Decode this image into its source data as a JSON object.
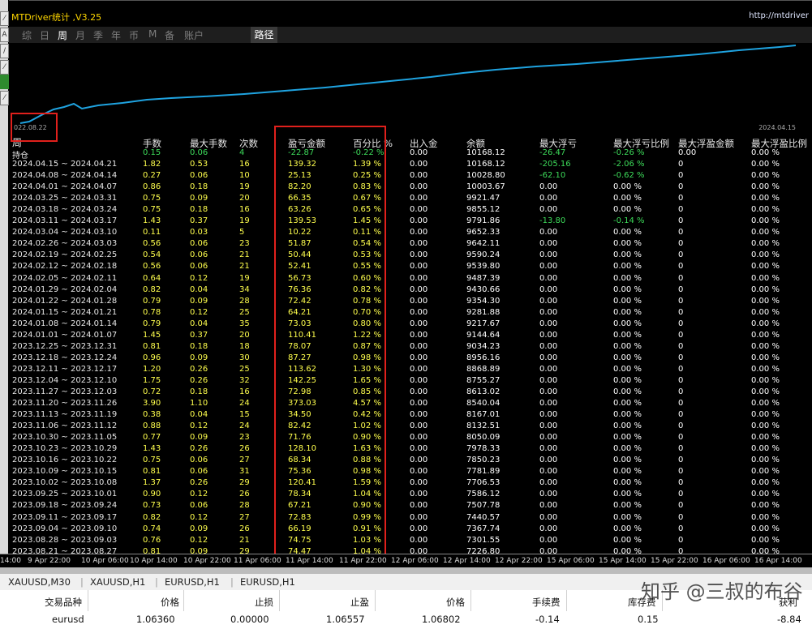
{
  "app": {
    "title": "MTDriver统计 ,V3.25",
    "url": "http://mtdriver"
  },
  "period_tabs": [
    "综",
    "日",
    "周",
    "月",
    "季",
    "年",
    "币",
    "M",
    "备",
    "账户"
  ],
  "active_tab": "周",
  "route_button": "路径",
  "chart": {
    "start_label": "022.08.22",
    "end_label": "2024.04.15"
  },
  "table": {
    "row_header": "周",
    "columns": [
      "手数",
      "最大手数",
      "次数",
      "盈亏金额",
      "百分比 %",
      "出入金",
      "余额",
      "最大浮亏",
      "最大浮亏比例",
      "最大浮盈金额",
      "最大浮盈比例"
    ],
    "rows": [
      [
        "持仓",
        "0.15",
        "0.06",
        "4",
        "-22.87",
        "-0.22 %",
        "0.00",
        "10168.12",
        "-26.47",
        "-0.26 %",
        "0.00",
        "0.00 %"
      ],
      [
        "2024.04.15 ~ 2024.04.21",
        "1.82",
        "0.53",
        "16",
        "139.32",
        "1.39 %",
        "0.00",
        "10168.12",
        "-205.16",
        "-2.06 %",
        "0",
        "0.00 %"
      ],
      [
        "2024.04.08 ~ 2024.04.14",
        "0.27",
        "0.06",
        "10",
        "25.13",
        "0.25 %",
        "0.00",
        "10028.80",
        "-62.10",
        "-0.62 %",
        "0",
        "0.00 %"
      ],
      [
        "2024.04.01 ~ 2024.04.07",
        "0.86",
        "0.18",
        "19",
        "82.20",
        "0.83 %",
        "0.00",
        "10003.67",
        "0.00",
        "0.00 %",
        "0",
        "0.00 %"
      ],
      [
        "2024.03.25 ~ 2024.03.31",
        "0.75",
        "0.09",
        "20",
        "66.35",
        "0.67 %",
        "0.00",
        "9921.47",
        "0.00",
        "0.00 %",
        "0",
        "0.00 %"
      ],
      [
        "2024.03.18 ~ 2024.03.24",
        "0.75",
        "0.18",
        "16",
        "63.26",
        "0.65 %",
        "0.00",
        "9855.12",
        "0.00",
        "0.00 %",
        "0",
        "0.00 %"
      ],
      [
        "2024.03.11 ~ 2024.03.17",
        "1.43",
        "0.37",
        "19",
        "139.53",
        "1.45 %",
        "0.00",
        "9791.86",
        "-13.80",
        "-0.14 %",
        "0",
        "0.00 %"
      ],
      [
        "2024.03.04 ~ 2024.03.10",
        "0.11",
        "0.03",
        "5",
        "10.22",
        "0.11 %",
        "0.00",
        "9652.33",
        "0.00",
        "0.00 %",
        "0",
        "0.00 %"
      ],
      [
        "2024.02.26 ~ 2024.03.03",
        "0.56",
        "0.06",
        "23",
        "51.87",
        "0.54 %",
        "0.00",
        "9642.11",
        "0.00",
        "0.00 %",
        "0",
        "0.00 %"
      ],
      [
        "2024.02.19 ~ 2024.02.25",
        "0.54",
        "0.06",
        "21",
        "50.44",
        "0.53 %",
        "0.00",
        "9590.24",
        "0.00",
        "0.00 %",
        "0",
        "0.00 %"
      ],
      [
        "2024.02.12 ~ 2024.02.18",
        "0.56",
        "0.06",
        "21",
        "52.41",
        "0.55 %",
        "0.00",
        "9539.80",
        "0.00",
        "0.00 %",
        "0",
        "0.00 %"
      ],
      [
        "2024.02.05 ~ 2024.02.11",
        "0.64",
        "0.12",
        "19",
        "56.73",
        "0.60 %",
        "0.00",
        "9487.39",
        "0.00",
        "0.00 %",
        "0",
        "0.00 %"
      ],
      [
        "2024.01.29 ~ 2024.02.04",
        "0.82",
        "0.04",
        "34",
        "76.36",
        "0.82 %",
        "0.00",
        "9430.66",
        "0.00",
        "0.00 %",
        "0",
        "0.00 %"
      ],
      [
        "2024.01.22 ~ 2024.01.28",
        "0.79",
        "0.09",
        "28",
        "72.42",
        "0.78 %",
        "0.00",
        "9354.30",
        "0.00",
        "0.00 %",
        "0",
        "0.00 %"
      ],
      [
        "2024.01.15 ~ 2024.01.21",
        "0.78",
        "0.12",
        "25",
        "64.21",
        "0.70 %",
        "0.00",
        "9281.88",
        "0.00",
        "0.00 %",
        "0",
        "0.00 %"
      ],
      [
        "2024.01.08 ~ 2024.01.14",
        "0.79",
        "0.04",
        "35",
        "73.03",
        "0.80 %",
        "0.00",
        "9217.67",
        "0.00",
        "0.00 %",
        "0",
        "0.00 %"
      ],
      [
        "2024.01.01 ~ 2024.01.07",
        "1.45",
        "0.37",
        "20",
        "110.41",
        "1.22 %",
        "0.00",
        "9144.64",
        "0.00",
        "0.00 %",
        "0",
        "0.00 %"
      ],
      [
        "2023.12.25 ~ 2023.12.31",
        "0.81",
        "0.18",
        "18",
        "78.07",
        "0.87 %",
        "0.00",
        "9034.23",
        "0.00",
        "0.00 %",
        "0",
        "0.00 %"
      ],
      [
        "2023.12.18 ~ 2023.12.24",
        "0.96",
        "0.09",
        "30",
        "87.27",
        "0.98 %",
        "0.00",
        "8956.16",
        "0.00",
        "0.00 %",
        "0",
        "0.00 %"
      ],
      [
        "2023.12.11 ~ 2023.12.17",
        "1.20",
        "0.26",
        "25",
        "113.62",
        "1.30 %",
        "0.00",
        "8868.89",
        "0.00",
        "0.00 %",
        "0",
        "0.00 %"
      ],
      [
        "2023.12.04 ~ 2023.12.10",
        "1.75",
        "0.26",
        "32",
        "142.25",
        "1.65 %",
        "0.00",
        "8755.27",
        "0.00",
        "0.00 %",
        "0",
        "0.00 %"
      ],
      [
        "2023.11.27 ~ 2023.12.03",
        "0.72",
        "0.18",
        "16",
        "72.98",
        "0.85 %",
        "0.00",
        "8613.02",
        "0.00",
        "0.00 %",
        "0",
        "0.00 %"
      ],
      [
        "2023.11.20 ~ 2023.11.26",
        "3.90",
        "1.10",
        "24",
        "373.03",
        "4.57 %",
        "0.00",
        "8540.04",
        "0.00",
        "0.00 %",
        "0",
        "0.00 %"
      ],
      [
        "2023.11.13 ~ 2023.11.19",
        "0.38",
        "0.04",
        "15",
        "34.50",
        "0.42 %",
        "0.00",
        "8167.01",
        "0.00",
        "0.00 %",
        "0",
        "0.00 %"
      ],
      [
        "2023.11.06 ~ 2023.11.12",
        "0.88",
        "0.12",
        "24",
        "82.42",
        "1.02 %",
        "0.00",
        "8132.51",
        "0.00",
        "0.00 %",
        "0",
        "0.00 %"
      ],
      [
        "2023.10.30 ~ 2023.11.05",
        "0.77",
        "0.09",
        "23",
        "71.76",
        "0.90 %",
        "0.00",
        "8050.09",
        "0.00",
        "0.00 %",
        "0",
        "0.00 %"
      ],
      [
        "2023.10.23 ~ 2023.10.29",
        "1.43",
        "0.26",
        "26",
        "128.10",
        "1.63 %",
        "0.00",
        "7978.33",
        "0.00",
        "0.00 %",
        "0",
        "0.00 %"
      ],
      [
        "2023.10.16 ~ 2023.10.22",
        "0.75",
        "0.06",
        "27",
        "68.34",
        "0.88 %",
        "0.00",
        "7850.23",
        "0.00",
        "0.00 %",
        "0",
        "0.00 %"
      ],
      [
        "2023.10.09 ~ 2023.10.15",
        "0.81",
        "0.06",
        "31",
        "75.36",
        "0.98 %",
        "0.00",
        "7781.89",
        "0.00",
        "0.00 %",
        "0",
        "0.00 %"
      ],
      [
        "2023.10.02 ~ 2023.10.08",
        "1.37",
        "0.26",
        "29",
        "120.41",
        "1.59 %",
        "0.00",
        "7706.53",
        "0.00",
        "0.00 %",
        "0",
        "0.00 %"
      ],
      [
        "2023.09.25 ~ 2023.10.01",
        "0.90",
        "0.12",
        "26",
        "78.34",
        "1.04 %",
        "0.00",
        "7586.12",
        "0.00",
        "0.00 %",
        "0",
        "0.00 %"
      ],
      [
        "2023.09.18 ~ 2023.09.24",
        "0.73",
        "0.06",
        "28",
        "67.21",
        "0.90 %",
        "0.00",
        "7507.78",
        "0.00",
        "0.00 %",
        "0",
        "0.00 %"
      ],
      [
        "2023.09.11 ~ 2023.09.17",
        "0.82",
        "0.12",
        "27",
        "72.83",
        "0.99 %",
        "0.00",
        "7440.57",
        "0.00",
        "0.00 %",
        "0",
        "0.00 %"
      ],
      [
        "2023.09.04 ~ 2023.09.10",
        "0.74",
        "0.09",
        "26",
        "66.19",
        "0.91 %",
        "0.00",
        "7367.74",
        "0.00",
        "0.00 %",
        "0",
        "0.00 %"
      ],
      [
        "2023.08.28 ~ 2023.09.03",
        "0.76",
        "0.12",
        "21",
        "74.75",
        "1.03 %",
        "0.00",
        "7301.55",
        "0.00",
        "0.00 %",
        "0",
        "0.00 %"
      ],
      [
        "2023.08.21 ~ 2023.08.27",
        "0.81",
        "0.09",
        "29",
        "74.47",
        "1.04 %",
        "0.00",
        "7226.80",
        "0.00",
        "0.00 %",
        "0",
        "0.00 %"
      ]
    ]
  },
  "time_axis": [
    "14:00",
    "9 Apr 22:00",
    "10 Apr 06:00",
    "10 Apr 14:00",
    "10 Apr 22:00",
    "11 Apr 06:00",
    "11 Apr 14:00",
    "11 Apr 22:00",
    "12 Apr 06:00",
    "12 Apr 14:00",
    "12 Apr 22:00",
    "15 Apr 06:00",
    "15 Apr 14:00",
    "15 Apr 22:00",
    "16 Apr 06:00",
    "16 Apr 14:00"
  ],
  "symbol_tabs": [
    "XAUUSD,M30",
    "XAUUSD,H1",
    "EURUSD,H1",
    "EURUSD,H1"
  ],
  "orders": {
    "headers": [
      "交易品种",
      "价格",
      "止损",
      "止盈",
      "价格",
      "手续费",
      "库存费",
      "获利"
    ],
    "row": [
      "eurusd",
      "1.06360",
      "0.00000",
      "1.06557",
      "1.06802",
      "-0.14",
      "0.15",
      "-8.84"
    ]
  },
  "watermark": "知乎 @三叔的布谷",
  "colors": {
    "line": "#1fa3e0",
    "highlight": "#e0201c",
    "profit": "#ffff4d",
    "loss": "#3ddc5a"
  }
}
